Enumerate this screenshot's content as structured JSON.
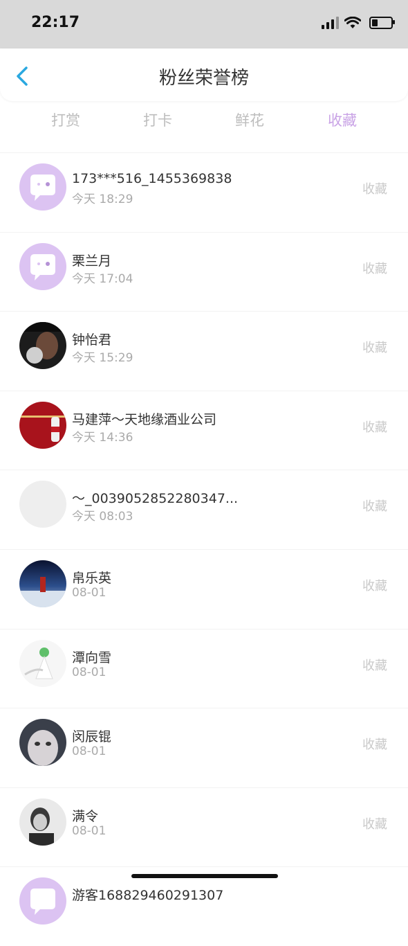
{
  "status_bar": {
    "time": "22:17"
  },
  "header": {
    "title": "粉丝荣誉榜"
  },
  "tabs": [
    {
      "label": "打赏"
    },
    {
      "label": "打卡"
    },
    {
      "label": "鲜花"
    },
    {
      "label": "收藏"
    }
  ],
  "active_tab": "收藏",
  "fans": [
    {
      "name": "173***516_1455369838",
      "time": "今天 18:29",
      "action": "收藏"
    },
    {
      "name": "栗兰月",
      "time": "今天 17:04",
      "action": "收藏"
    },
    {
      "name": "钟怡君",
      "time": "今天 15:29",
      "action": "收藏"
    },
    {
      "name": "马建萍～天地缘酒业公司",
      "time": "今天 14:36",
      "action": "收藏"
    },
    {
      "name": "～_003905285228034​7...",
      "time": "今天 08:03",
      "action": "收藏"
    },
    {
      "name": "帛乐英",
      "time": "08-01",
      "action": "收藏"
    },
    {
      "name": "潭向雪",
      "time": "08-01",
      "action": "收藏"
    },
    {
      "name": "闵辰锟",
      "time": "08-01",
      "action": "收藏"
    },
    {
      "name": "满令",
      "time": "08-01",
      "action": "收藏"
    },
    {
      "name": "游客1688294602913​07",
      "time": "",
      "action": ""
    }
  ],
  "colors": {
    "accent": "#c9a3e6",
    "back_icon": "#2aa8e0",
    "muted": "#c9c9c9"
  }
}
